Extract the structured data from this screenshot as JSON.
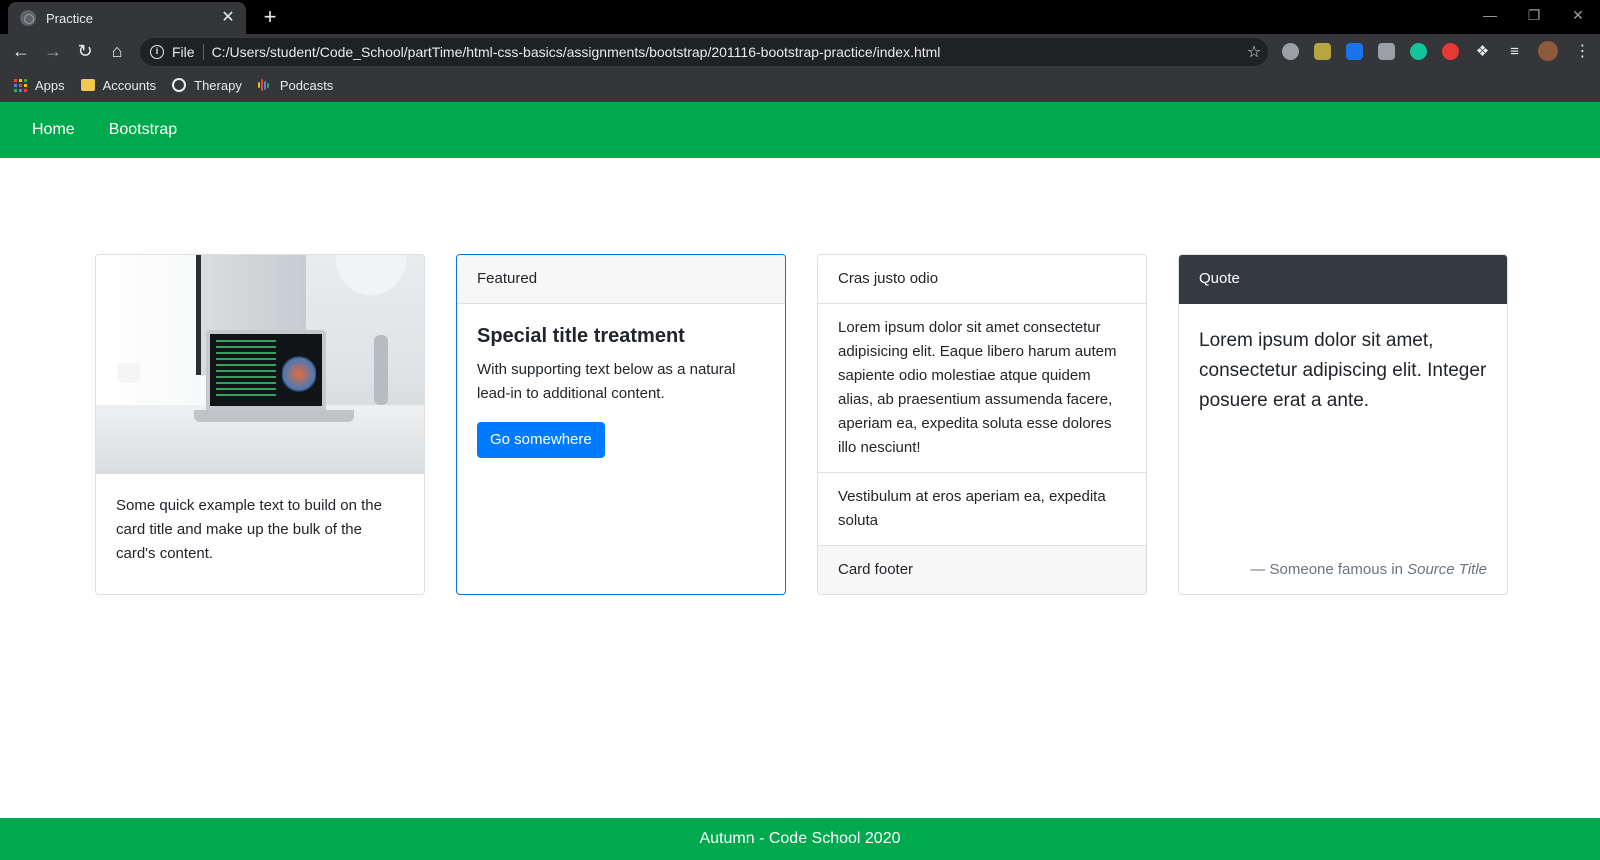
{
  "browser": {
    "tab_title": "Practice",
    "tab_close": "✕",
    "new_tab": "+",
    "scheme": "File",
    "url": "C:/Users/student/Code_School/partTime/html-css-basics/assignments/bootstrap/201116-bootstrap-practice/index.html",
    "bookmarks": [
      {
        "label": "Apps",
        "icon": "apps-grid-icon"
      },
      {
        "label": "Accounts",
        "icon": "folder-icon"
      },
      {
        "label": "Therapy",
        "icon": "globe-icon"
      },
      {
        "label": "Podcasts",
        "icon": "podcasts-icon"
      }
    ]
  },
  "nav": {
    "items": [
      "Home",
      "Bootstrap"
    ]
  },
  "cards": {
    "image_card": {
      "text": "Some quick example text to build on the card title and make up the bulk of the card's content."
    },
    "featured_card": {
      "header": "Featured",
      "title": "Special title treatment",
      "text": "With supporting text below as a natural lead-in to additional content.",
      "button": "Go somewhere"
    },
    "list_card": {
      "header": "Cras justo odio",
      "items": [
        "Lorem ipsum dolor sit amet consectetur adipisicing elit. Eaque libero harum autem sapiente odio molestiae atque quidem alias, ab praesentium assumenda facere, aperiam ea, expedita soluta esse dolores illo nesciunt!",
        "Vestibulum at eros aperiam ea, expedita soluta"
      ],
      "footer": "Card footer"
    },
    "quote_card": {
      "header": "Quote",
      "quote": "Lorem ipsum dolor sit amet, consectetur adipiscing elit. Integer posuere erat a ante.",
      "attribution_prefix": "— Someone famous in",
      "source": "Source Title"
    }
  },
  "footer": {
    "text": "Autumn - Code School 2020"
  },
  "colors": {
    "nav_green": "#00a94e",
    "primary_blue": "#007bff",
    "dark_header": "#343a40"
  }
}
